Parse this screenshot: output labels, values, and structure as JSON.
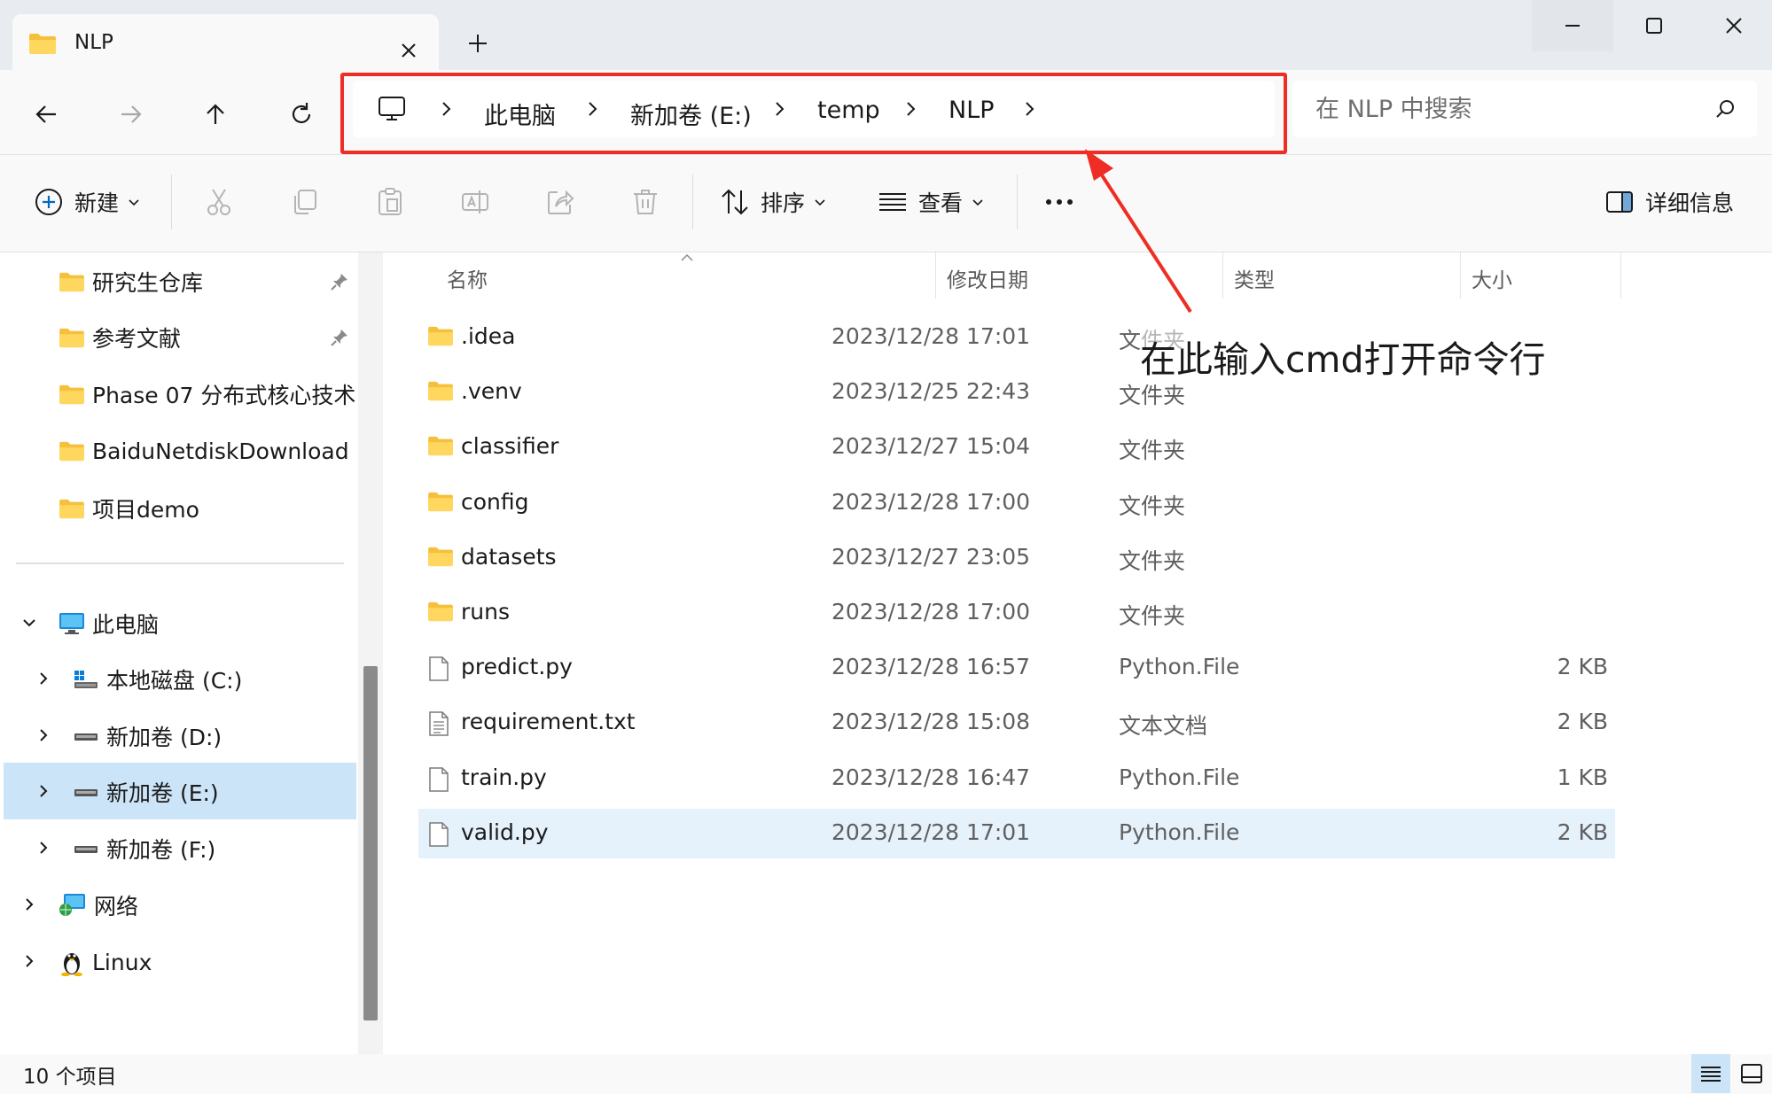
{
  "tab": {
    "title": "NLP",
    "close": "close",
    "new_tab": "new tab"
  },
  "breadcrumb": [
    "此电脑",
    "新加卷 (E:)",
    "temp",
    "NLP"
  ],
  "search": {
    "placeholder": "在 NLP 中搜索"
  },
  "toolbar": {
    "new_label": "新建",
    "sort_label": "排序",
    "view_label": "查看",
    "details_label": "详细信息"
  },
  "sidebar": {
    "quick": [
      {
        "label": "研究生仓库",
        "pinned": true
      },
      {
        "label": "参考文献",
        "pinned": true
      },
      {
        "label": "Phase 07 分布式核心技术",
        "pinned": false
      },
      {
        "label": "BaiduNetdiskDownload",
        "pinned": false
      },
      {
        "label": "项目demo",
        "pinned": false
      }
    ],
    "this_pc": "此电脑",
    "drives": [
      "本地磁盘 (C:)",
      "新加卷 (D:)",
      "新加卷 (E:)",
      "新加卷 (F:)"
    ],
    "network": "网络",
    "linux": "Linux"
  },
  "columns": {
    "name": "名称",
    "date": "修改日期",
    "type": "类型",
    "size": "大小"
  },
  "files": [
    {
      "name": ".idea",
      "date": "2023/12/28 17:01",
      "type": "文件夹",
      "size": "",
      "icon": "folder-icon"
    },
    {
      "name": ".venv",
      "date": "2023/12/25 22:43",
      "type": "文件夹",
      "size": "",
      "icon": "folder-icon"
    },
    {
      "name": "classifier",
      "date": "2023/12/27 15:04",
      "type": "文件夹",
      "size": "",
      "icon": "folder-icon"
    },
    {
      "name": "config",
      "date": "2023/12/28 17:00",
      "type": "文件夹",
      "size": "",
      "icon": "folder-icon"
    },
    {
      "name": "datasets",
      "date": "2023/12/27 23:05",
      "type": "文件夹",
      "size": "",
      "icon": "folder-icon"
    },
    {
      "name": "runs",
      "date": "2023/12/28 17:00",
      "type": "文件夹",
      "size": "",
      "icon": "folder-icon"
    },
    {
      "name": "predict.py",
      "date": "2023/12/28 16:57",
      "type": "Python.File",
      "size": "2 KB",
      "icon": "file-icon"
    },
    {
      "name": "requirement.txt",
      "date": "2023/12/28 15:08",
      "type": "文本文档",
      "size": "2 KB",
      "icon": "text-file-icon"
    },
    {
      "name": "train.py",
      "date": "2023/12/28 16:47",
      "type": "Python.File",
      "size": "1 KB",
      "icon": "file-icon"
    },
    {
      "name": "valid.py",
      "date": "2023/12/28 17:01",
      "type": "Python.File",
      "size": "2 KB",
      "icon": "file-icon"
    }
  ],
  "status": {
    "count": "10 个项目"
  },
  "annotation": "在此输入cmd打开命令行",
  "colors": {
    "accent": "#0067c0",
    "highlight_box": "#ee2e24",
    "selection": "#cce4f7",
    "row_selection": "#e5f1fb",
    "folder": "#f5c03b"
  }
}
